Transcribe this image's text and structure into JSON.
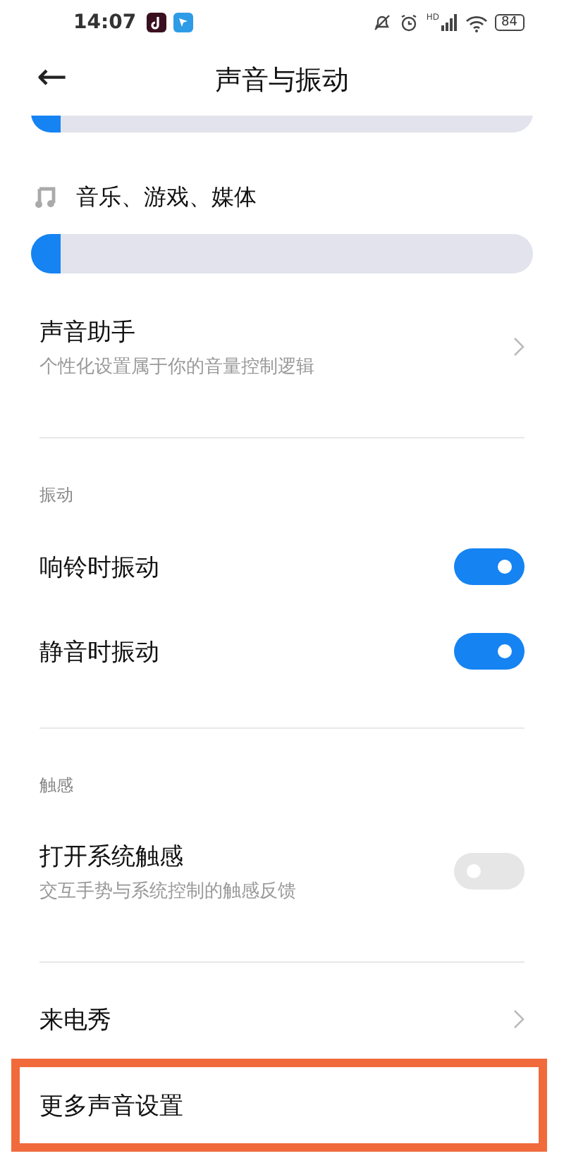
{
  "status_bar": {
    "time": "14:07",
    "network_label": "HD",
    "battery": "84"
  },
  "header": {
    "back": "←",
    "title": "声音与振动"
  },
  "top_slider": {
    "level": 0.06
  },
  "media": {
    "label": "音乐、游戏、媒体",
    "level": 0.06
  },
  "sections": [
    {
      "items": [
        {
          "kind": "link",
          "title": "声音助手",
          "subtitle": "个性化设置属于你的音量控制逻辑",
          "highlighted": false
        }
      ]
    },
    {
      "header": "振动",
      "items": [
        {
          "kind": "switch",
          "title": "响铃时振动",
          "on": true,
          "highlighted": false
        },
        {
          "kind": "switch",
          "title": "静音时振动",
          "on": true,
          "highlighted": false
        }
      ]
    },
    {
      "header": "触感",
      "items": [
        {
          "kind": "switch",
          "title": "打开系统触感",
          "subtitle": "交互手势与系统控制的触感反馈",
          "on": false,
          "highlighted": false
        }
      ]
    },
    {
      "items": [
        {
          "kind": "link",
          "title": "来电秀",
          "highlighted": false
        },
        {
          "kind": "plain",
          "title": "更多声音设置",
          "highlighted": true
        }
      ]
    }
  ]
}
